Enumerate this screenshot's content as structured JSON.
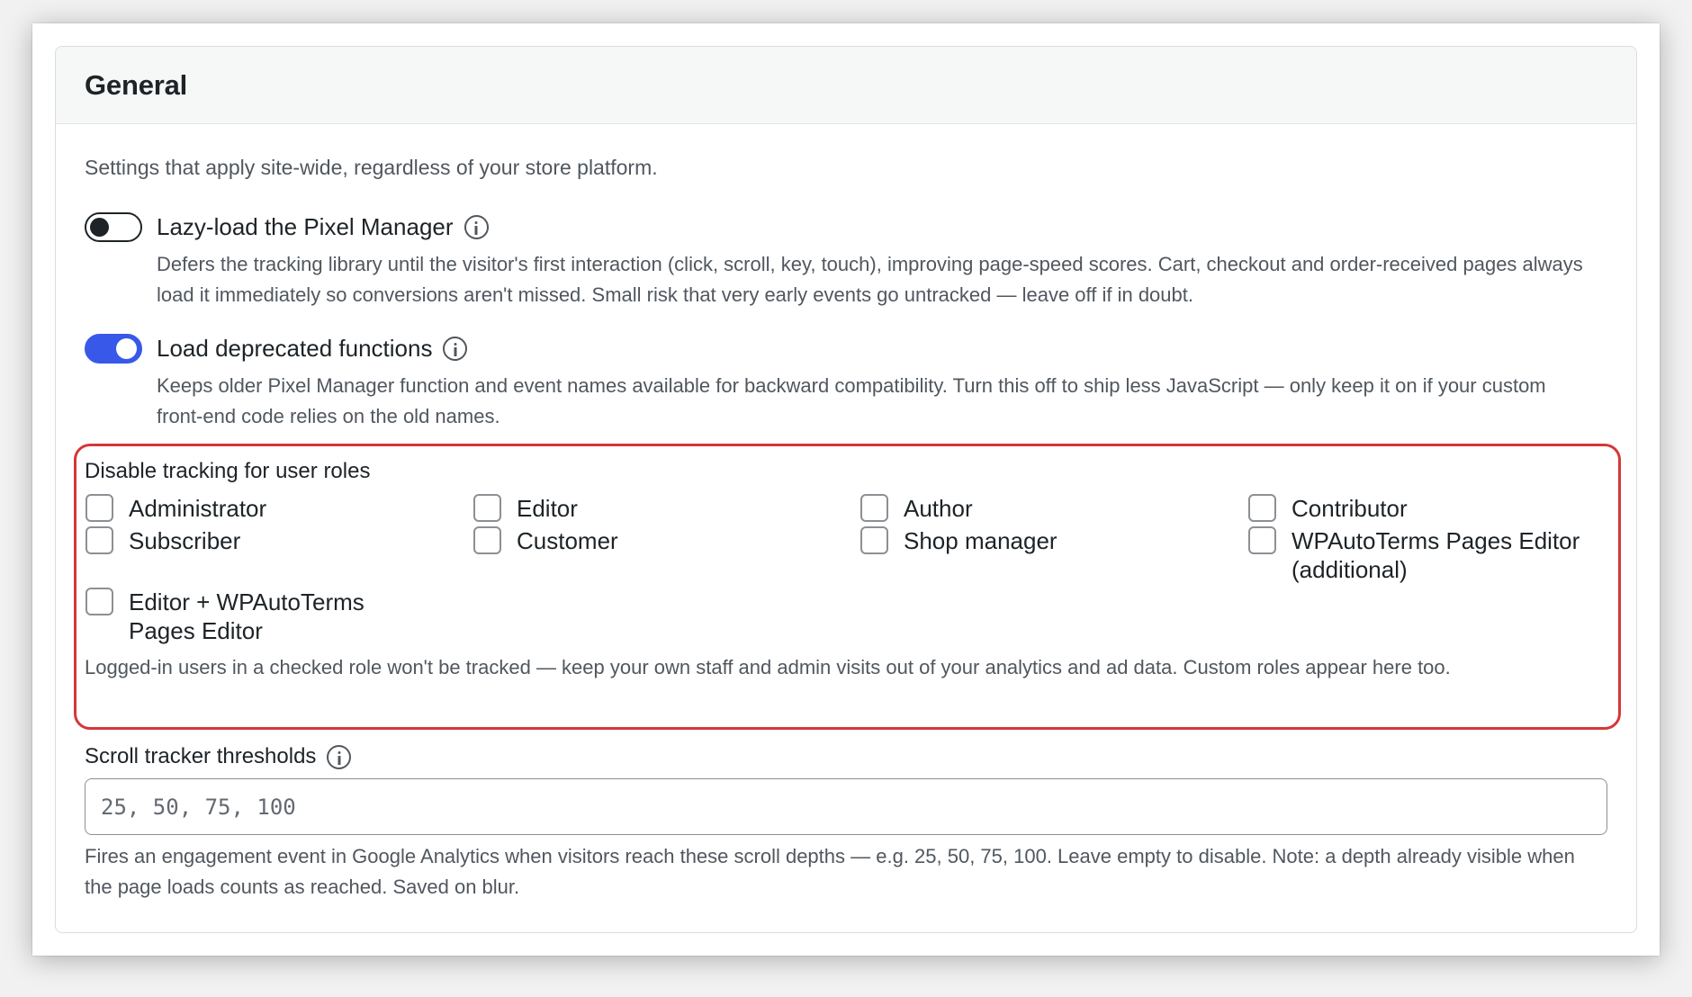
{
  "card": {
    "title": "General",
    "intro": "Settings that apply site-wide, regardless of your store platform."
  },
  "lazy_load": {
    "label": "Lazy-load the Pixel Manager",
    "enabled": false,
    "description": "Defers the tracking library until the visitor's first interaction (click, scroll, key, touch), improving page-speed scores. Cart, checkout and order-received pages always load it immediately so conversions aren't missed. Small risk that very early events go untracked — leave off if in doubt."
  },
  "deprecated": {
    "label": "Load deprecated functions",
    "enabled": true,
    "description": "Keeps older Pixel Manager function and event names available for backward compatibility. Turn this off to ship less JavaScript — only keep it on if your custom front-end code relies on the old names."
  },
  "roles": {
    "title": "Disable tracking for user roles",
    "items": [
      {
        "label": "Administrator",
        "checked": false
      },
      {
        "label": "Editor",
        "checked": false
      },
      {
        "label": "Author",
        "checked": false
      },
      {
        "label": "Contributor",
        "checked": false
      },
      {
        "label": "Subscriber",
        "checked": false
      },
      {
        "label": "Customer",
        "checked": false
      },
      {
        "label": "Shop manager",
        "checked": false
      },
      {
        "label": "WPAutoTerms Pages Editor (additional)",
        "checked": false
      },
      {
        "label": "Editor + WPAutoTerms Pages Editor",
        "checked": false
      }
    ],
    "note": "Logged-in users in a checked role won't be tracked — keep your own staff and admin visits out of your analytics and ad data. Custom roles appear here too."
  },
  "scroll": {
    "label": "Scroll tracker thresholds",
    "placeholder": "25, 50, 75, 100",
    "value": "",
    "description": "Fires an engagement event in Google Analytics when visitors reach these scroll depths — e.g. 25, 50, 75, 100. Leave empty to disable. Note: a depth already visible when the page loads counts as reached. Saved on blur."
  },
  "colors": {
    "toggle_on": "#3858e9",
    "highlight_border": "#d63638"
  }
}
